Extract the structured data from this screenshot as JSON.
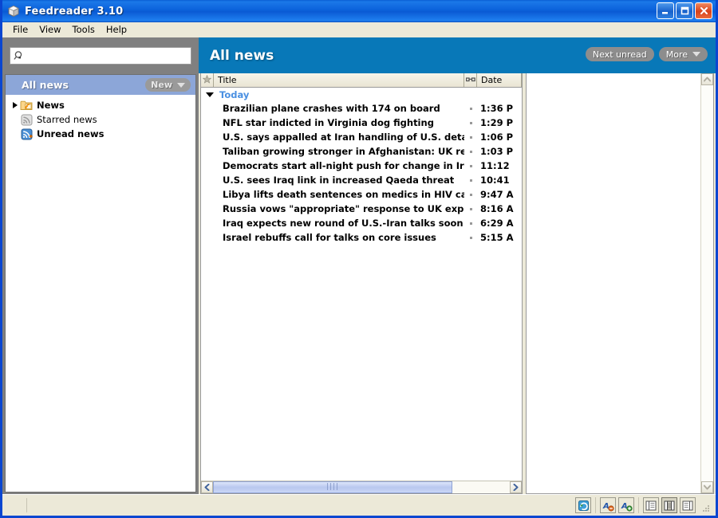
{
  "window": {
    "title": "Feedreader 3.10",
    "icon": "app-cube-icon",
    "buttons": {
      "minimize": "minimize",
      "maximize": "maximize",
      "close": "close"
    }
  },
  "menubar": {
    "items": [
      "File",
      "View",
      "Tools",
      "Help"
    ]
  },
  "sidebar": {
    "search": {
      "value": "",
      "placeholder": "",
      "icon": "search-icon"
    },
    "header": {
      "label": "All news",
      "new_button": {
        "label": "New",
        "icon": "chevron-down-icon"
      }
    },
    "tree": [
      {
        "label": "News",
        "icon": "folder-rss-icon",
        "bold": true,
        "expandable": true
      },
      {
        "label": "Starred news",
        "icon": "rss-gray-icon",
        "bold": false,
        "expandable": false
      },
      {
        "label": "Unread news",
        "icon": "rss-blue-icon",
        "bold": true,
        "expandable": false
      }
    ]
  },
  "main": {
    "header": {
      "title": "All news",
      "next_unread_label": "Next unread",
      "more_label": "More",
      "more_icon": "chevron-down-icon"
    },
    "columns": {
      "star": "star-icon",
      "title": "Title",
      "read": "read-glasses-icon",
      "date": "Date"
    },
    "group": {
      "label": "Today",
      "icon": "triangle-down-icon",
      "expanded": true
    },
    "items": [
      {
        "title": "Brazilian plane crashes with 174 on board",
        "date": "1:36 P"
      },
      {
        "title": "NFL star indicted in Virginia dog fighting",
        "date": "1:29 P"
      },
      {
        "title": "U.S. says appalled  at Iran handling of U.S. detainees",
        "date": "1:06 P"
      },
      {
        "title": "Taliban growing stronger in Afghanistan: UK report",
        "date": "1:03 P"
      },
      {
        "title": "Democrats start all-night push for change in Iraq",
        "date": "11:12"
      },
      {
        "title": "U.S. sees Iraq link in increased Qaeda threat",
        "date": "10:41"
      },
      {
        "title": "Libya lifts death sentences on medics in HIV case",
        "date": "9:47 A"
      },
      {
        "title": "Russia vows \"appropriate\" response to UK expulsions",
        "date": "8:16 A"
      },
      {
        "title": "Iraq expects new round of U.S.-Iran talks soon",
        "date": "6:29 A"
      },
      {
        "title": "Israel rebuffs call for talks on core issues",
        "date": "5:15 A"
      }
    ],
    "hscroll": {
      "left_icon": "arrow-left-icon",
      "right_icon": "arrow-right-icon",
      "grip": "||||"
    },
    "preview": {
      "content": ""
    },
    "vscroll": {
      "up_icon": "arrow-up-icon",
      "down_icon": "arrow-down-icon"
    }
  },
  "statusbar": {
    "text": "",
    "buttons": [
      {
        "name": "refresh-feeds-icon",
        "selected": false
      },
      {
        "name": "font-decrease-icon",
        "selected": false
      },
      {
        "name": "font-increase-icon",
        "selected": false
      },
      {
        "name": "layout-bottom-preview-icon",
        "selected": false
      },
      {
        "name": "layout-side-preview-icon",
        "selected": true
      },
      {
        "name": "layout-no-preview-icon",
        "selected": false
      }
    ]
  },
  "colors": {
    "titlebar_blue": "#0c63dc",
    "header_blue": "#0878b8",
    "sidebar_gray": "#808080",
    "selection_blue": "#8ca6d8",
    "chrome_beige": "#ece9d8",
    "group_label_blue": "#4a90e2"
  }
}
